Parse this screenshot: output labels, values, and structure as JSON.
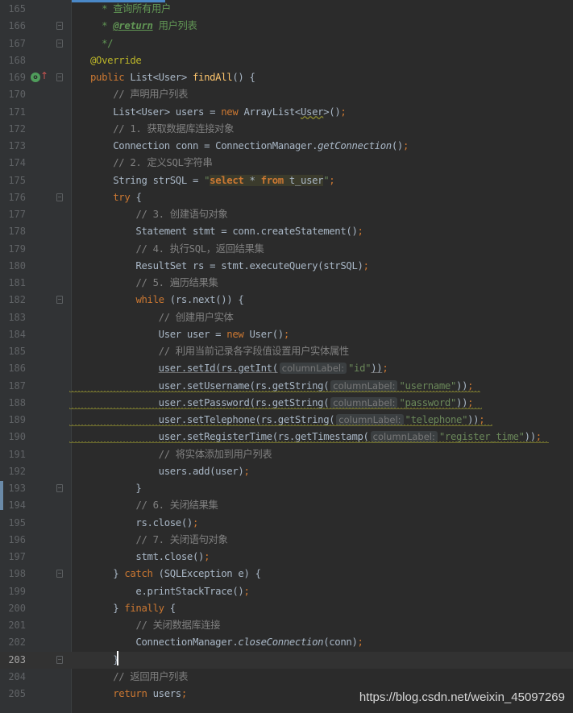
{
  "watermark": "https://blog.csdn.net/weixin_45097269",
  "gutter_icons": {
    "override": "override-marker-icon",
    "implements": "up-arrow-icon"
  },
  "colors": {
    "background": "#2b2b2b",
    "gutter": "#313335",
    "keyword": "#cc7832",
    "comment": "#808080",
    "string": "#6a8759",
    "method": "#ffc66d",
    "annotation": "#bbb529",
    "javadoc": "#629755"
  },
  "lines": [
    {
      "n": "165",
      "fold": false,
      "tokens": [
        [
          "  ",
          "p"
        ],
        [
          "* ",
          "jd"
        ],
        [
          "查询所有用户",
          "jd"
        ]
      ]
    },
    {
      "n": "166",
      "fold": true,
      "tokens": [
        [
          "  ",
          "p"
        ],
        [
          "* ",
          "jd"
        ],
        [
          "@return",
          "jtag"
        ],
        [
          " 用户列表",
          "jd"
        ]
      ]
    },
    {
      "n": "167",
      "fold": true,
      "tokens": [
        [
          "  ",
          "p"
        ],
        [
          "*/",
          "jd"
        ]
      ]
    },
    {
      "n": "168",
      "fold": false,
      "tokens": [
        [
          "@Override",
          "ann"
        ]
      ]
    },
    {
      "n": "169",
      "fold": true,
      "tokens": [
        [
          "public ",
          "kw"
        ],
        [
          "List<User> ",
          "p"
        ],
        [
          "findAll",
          "fn"
        ],
        [
          "() {",
          "p"
        ]
      ]
    },
    {
      "n": "170",
      "fold": false,
      "tokens": [
        [
          "    ",
          "p"
        ],
        [
          "// 声明用户列表",
          "cm"
        ]
      ]
    },
    {
      "n": "171",
      "fold": false,
      "tokens": [
        [
          "    List<User> users = ",
          "p"
        ],
        [
          "new ",
          "kw"
        ],
        [
          "ArrayList<",
          "p"
        ],
        [
          "User",
          "warn"
        ],
        [
          ">()",
          "p"
        ],
        [
          ";",
          "kw"
        ]
      ]
    },
    {
      "n": "172",
      "fold": false,
      "tokens": [
        [
          "    ",
          "p"
        ],
        [
          "// 1. 获取数据库连接对象",
          "cm"
        ]
      ]
    },
    {
      "n": "173",
      "fold": false,
      "tokens": [
        [
          "    Connection conn = ConnectionManager.",
          "p"
        ],
        [
          "getConnection",
          "it"
        ],
        [
          "()",
          "p"
        ],
        [
          ";",
          "kw"
        ]
      ]
    },
    {
      "n": "174",
      "fold": false,
      "tokens": [
        [
          "    ",
          "p"
        ],
        [
          "// 2. 定义SQL字符串",
          "cm"
        ]
      ]
    },
    {
      "n": "175",
      "fold": false,
      "tokens": [
        [
          "    String strSQL = ",
          "p"
        ],
        [
          "\"",
          "str"
        ],
        [
          "select",
          "sqlkw"
        ],
        [
          " * ",
          "sql"
        ],
        [
          "from",
          "sqlkw"
        ],
        [
          " t_user",
          "sql"
        ],
        [
          "\"",
          "str"
        ],
        [
          ";",
          "kw"
        ]
      ]
    },
    {
      "n": "176",
      "fold": true,
      "tokens": [
        [
          "    ",
          "p"
        ],
        [
          "try ",
          "kw"
        ],
        [
          "{",
          "p"
        ]
      ]
    },
    {
      "n": "177",
      "fold": false,
      "tokens": [
        [
          "        ",
          "p"
        ],
        [
          "// 3. 创建语句对象",
          "cm"
        ]
      ]
    },
    {
      "n": "178",
      "fold": false,
      "tokens": [
        [
          "        Statement stmt = conn.createStatement()",
          "p"
        ],
        [
          ";",
          "kw"
        ]
      ]
    },
    {
      "n": "179",
      "fold": false,
      "tokens": [
        [
          "        ",
          "p"
        ],
        [
          "// 4. 执行SQL，返回结果集",
          "cm"
        ]
      ]
    },
    {
      "n": "180",
      "fold": false,
      "tokens": [
        [
          "        ResultSet rs = stmt.executeQuery(strSQL)",
          "p"
        ],
        [
          ";",
          "kw"
        ]
      ]
    },
    {
      "n": "181",
      "fold": false,
      "tokens": [
        [
          "        ",
          "p"
        ],
        [
          "// 5. 遍历结果集",
          "cm"
        ]
      ]
    },
    {
      "n": "182",
      "fold": true,
      "tokens": [
        [
          "        ",
          "p"
        ],
        [
          "while ",
          "kw"
        ],
        [
          "(rs.next()) {",
          "p"
        ]
      ]
    },
    {
      "n": "183",
      "fold": false,
      "tokens": [
        [
          "            ",
          "p"
        ],
        [
          "// 创建用户实体",
          "cm"
        ]
      ]
    },
    {
      "n": "184",
      "fold": false,
      "tokens": [
        [
          "            User user = ",
          "p"
        ],
        [
          "new ",
          "kw"
        ],
        [
          "User()",
          "p"
        ],
        [
          ";",
          "kw"
        ]
      ]
    },
    {
      "n": "185",
      "fold": false,
      "tokens": [
        [
          "            ",
          "p"
        ],
        [
          "// 利用当前记录各字段值设置用户实体属性",
          "cm"
        ]
      ]
    },
    {
      "n": "186",
      "fold": false,
      "tokens": [
        [
          "            ",
          "p"
        ],
        [
          "user.setId(rs.getInt(",
          "ul"
        ],
        [
          "columnLabel:",
          "hint"
        ],
        [
          "\"id\"",
          "str"
        ],
        [
          "))",
          "ul"
        ],
        [
          ";",
          "kw"
        ]
      ]
    },
    {
      "n": "187",
      "fold": false,
      "tokens": [
        [
          "            user.setUsername(rs.getString(",
          "p"
        ],
        [
          "columnLabel:",
          "hint"
        ],
        [
          "\"username\"",
          "str"
        ],
        [
          "))",
          "p"
        ],
        [
          ";",
          "kw"
        ]
      ]
    },
    {
      "n": "188",
      "fold": false,
      "tokens": [
        [
          "            user.setPassword(rs.getString(",
          "p"
        ],
        [
          "columnLabel:",
          "hint"
        ],
        [
          "\"password\"",
          "str"
        ],
        [
          "))",
          "p"
        ],
        [
          ";",
          "kw"
        ]
      ]
    },
    {
      "n": "189",
      "fold": false,
      "tokens": [
        [
          "            user.setTelephone(rs.getString(",
          "p"
        ],
        [
          "columnLabel:",
          "hint"
        ],
        [
          "\"telephone\"",
          "str"
        ],
        [
          "))",
          "p"
        ],
        [
          ";",
          "kw"
        ]
      ]
    },
    {
      "n": "190",
      "fold": false,
      "tokens": [
        [
          "            user.setRegisterTime(rs.getTimestamp(",
          "p"
        ],
        [
          "columnLabel:",
          "hint"
        ],
        [
          "\"register_time\"",
          "str"
        ],
        [
          "))",
          "p"
        ],
        [
          ";",
          "kw"
        ]
      ]
    },
    {
      "n": "191",
      "fold": false,
      "tokens": [
        [
          "            ",
          "p"
        ],
        [
          "// 将实体添加到用户列表",
          "cm"
        ]
      ]
    },
    {
      "n": "192",
      "fold": false,
      "tokens": [
        [
          "            users.add(user)",
          "p"
        ],
        [
          ";",
          "kw"
        ]
      ]
    },
    {
      "n": "193",
      "fold": true,
      "tokens": [
        [
          "        }",
          "p"
        ]
      ]
    },
    {
      "n": "194",
      "fold": false,
      "tokens": [
        [
          "        ",
          "p"
        ],
        [
          "// 6. 关闭结果集",
          "cm"
        ]
      ]
    },
    {
      "n": "195",
      "fold": false,
      "tokens": [
        [
          "        rs.close()",
          "p"
        ],
        [
          ";",
          "kw"
        ]
      ]
    },
    {
      "n": "196",
      "fold": false,
      "tokens": [
        [
          "        ",
          "p"
        ],
        [
          "// 7. 关闭语句对象",
          "cm"
        ]
      ]
    },
    {
      "n": "197",
      "fold": false,
      "tokens": [
        [
          "        stmt.close()",
          "p"
        ],
        [
          ";",
          "kw"
        ]
      ]
    },
    {
      "n": "198",
      "fold": true,
      "tokens": [
        [
          "    } ",
          "p"
        ],
        [
          "catch ",
          "kw"
        ],
        [
          "(SQLException e) {",
          "p"
        ]
      ]
    },
    {
      "n": "199",
      "fold": false,
      "tokens": [
        [
          "        e.printStackTrace()",
          "p"
        ],
        [
          ";",
          "kw"
        ]
      ]
    },
    {
      "n": "200",
      "fold": false,
      "tokens": [
        [
          "    } ",
          "p"
        ],
        [
          "finally ",
          "kw"
        ],
        [
          "{",
          "p"
        ]
      ]
    },
    {
      "n": "201",
      "fold": false,
      "tokens": [
        [
          "        ",
          "p"
        ],
        [
          "// 关闭数据库连接",
          "cm"
        ]
      ]
    },
    {
      "n": "202",
      "fold": false,
      "tokens": [
        [
          "        ConnectionManager.",
          "p"
        ],
        [
          "closeConnection",
          "it"
        ],
        [
          "(conn)",
          "p"
        ],
        [
          ";",
          "kw"
        ]
      ]
    },
    {
      "n": "203",
      "fold": true,
      "current": true,
      "tokens": [
        [
          "    }",
          "p"
        ]
      ]
    },
    {
      "n": "204",
      "fold": false,
      "tokens": [
        [
          "    ",
          "p"
        ],
        [
          "// 返回用户列表",
          "cm"
        ]
      ]
    },
    {
      "n": "205",
      "fold": false,
      "tokens": [
        [
          "    ",
          "p"
        ],
        [
          "return ",
          "kw"
        ],
        [
          "users",
          "p"
        ],
        [
          ";",
          "kw"
        ]
      ]
    }
  ]
}
